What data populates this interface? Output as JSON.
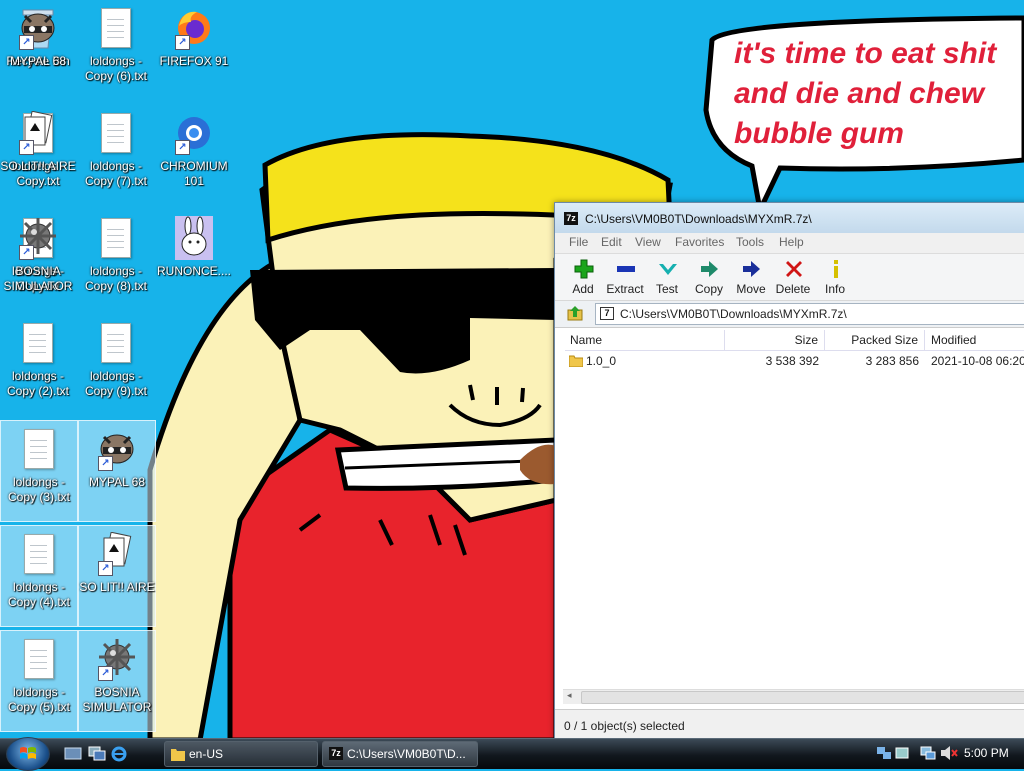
{
  "wallpaper": {
    "speech_lines": [
      "it's time to eat shit",
      "and die and chew",
      "bubble gum"
    ]
  },
  "desktop_icons": [
    {
      "label": "Recycle Bin",
      "kind": "recycle-bin",
      "selected": false
    },
    {
      "label": "MYPAL 68",
      "kind": "shortcut-raccoon",
      "selected": false
    },
    {
      "label": "loldongs - Copy.txt",
      "kind": "text-file",
      "selected": false
    },
    {
      "label": "SO LIT!! AIRE",
      "kind": "shortcut-cards",
      "selected": false
    },
    {
      "label": "loldongs - Copy.txt",
      "kind": "text-file",
      "selected": false
    },
    {
      "label": "BOSNIA SIMULATOR",
      "kind": "shortcut-mine",
      "selected": false
    },
    {
      "label": "loldongs - Copy (2).txt",
      "kind": "text-file",
      "selected": false
    },
    {
      "label": "loldongs - Copy (3).txt",
      "kind": "text-file",
      "selected": true
    },
    {
      "label": "loldongs - Copy (4).txt",
      "kind": "text-file",
      "selected": true
    },
    {
      "label": "loldongs - Copy (5).txt",
      "kind": "text-file",
      "selected": true
    },
    {
      "label": "loldongs - Copy (6).txt",
      "kind": "text-file",
      "selected": false
    },
    {
      "label": "loldongs - Copy (7).txt",
      "kind": "text-file",
      "selected": false
    },
    {
      "label": "loldongs - Copy (8).txt",
      "kind": "text-file",
      "selected": false
    },
    {
      "label": "loldongs - Copy (9).txt",
      "kind": "text-file",
      "selected": false
    },
    {
      "label": "MYPAL 68",
      "kind": "shortcut-raccoon",
      "selected": true
    },
    {
      "label": "SO LIT!! AIRE",
      "kind": "shortcut-cards",
      "selected": true
    },
    {
      "label": "BOSNIA SIMULATOR",
      "kind": "shortcut-mine",
      "selected": true
    },
    {
      "label": "FIREFOX 91",
      "kind": "shortcut-firefox",
      "selected": false
    },
    {
      "label": "CHROMIUM 101",
      "kind": "shortcut-chromium",
      "selected": false
    },
    {
      "label": "RUNONCE....",
      "kind": "bunny",
      "selected": false
    }
  ],
  "archive_window": {
    "title": "C:\\Users\\VM0B0T\\Downloads\\MYXmR.7z\\",
    "menu": [
      "File",
      "Edit",
      "View",
      "Favorites",
      "Tools",
      "Help"
    ],
    "toolbar": [
      {
        "label": "Add",
        "icon": "plus-icon",
        "color": "#1aa51a"
      },
      {
        "label": "Extract",
        "icon": "minus-icon",
        "color": "#1a35b5"
      },
      {
        "label": "Test",
        "icon": "check-icon",
        "color": "#16a0a0"
      },
      {
        "label": "Copy",
        "icon": "double-arrow-icon",
        "color": "#1e8a6a"
      },
      {
        "label": "Move",
        "icon": "arrow-right-icon",
        "color": "#1a2f9a"
      },
      {
        "label": "Delete",
        "icon": "x-icon",
        "color": "#d01515"
      },
      {
        "label": "Info",
        "icon": "info-icon",
        "color": "#d6c000"
      }
    ],
    "address": "C:\\Users\\VM0B0T\\Downloads\\MYXmR.7z\\",
    "columns": [
      "Name",
      "Size",
      "Packed Size",
      "Modified"
    ],
    "rows": [
      {
        "name": "1.0_0",
        "size": "3 538 392",
        "packed": "3 283 856",
        "modified": "2021-10-08 06:20"
      }
    ],
    "status": "0 / 1 object(s) selected"
  },
  "taskbar": {
    "tasks": [
      {
        "label": "en-US",
        "icon": "folder-icon"
      },
      {
        "label": "C:\\Users\\VM0B0T\\D...",
        "icon": "sevenzip-icon"
      }
    ],
    "clock": "5:00 PM"
  }
}
